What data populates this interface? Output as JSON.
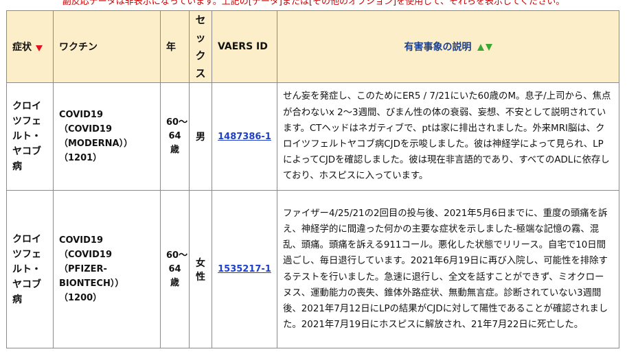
{
  "top_note": "副反応データは非表示になっています。上記の[データ]または[その他のオプション]を使用して、それらを表示してください。",
  "headers": {
    "symptom": "症状",
    "vaccine": "ワクチン",
    "year": "年",
    "sex": [
      "セ",
      "ッ",
      "ク",
      "ス"
    ],
    "vaers_id": "VAERS ID",
    "description": "有害事象の説明"
  },
  "rows": [
    {
      "symptom": [
        "クロイ",
        "ツフェ",
        "ルト・",
        "ヤコブ",
        "病"
      ],
      "vaccine": [
        "COVID19（COVID19",
        "（MODERNA））",
        "（1201）"
      ],
      "age": [
        "60〜",
        "64歳"
      ],
      "sex": "男",
      "vaers_id": "1487386-1",
      "description": "せん妄を発症し、このためにER5 / 7/21にいた60歳のM。息子/上司から、焦点が合わないx 2〜3週間、びまん性の体の衰弱、妄想、不安として説明されています。CTヘッドはネガティブで、ptは家に排出されました。外来MRI脳は、クロイツフェルトヤコブ病CJDを示唆しました。彼は神経学によって見られ、LPによってCJDを確認しました。彼は現在非言語的であり、すべてのADLに依存しており、ホスピスに入っています。"
    },
    {
      "symptom": [
        "クロイ",
        "ツフェ",
        "ルト・",
        "ヤコブ",
        "病"
      ],
      "vaccine": [
        "COVID19（COVID19",
        "（PFIZER-",
        "BIONTECH））",
        "（1200）"
      ],
      "age": [
        "60〜",
        "64歳"
      ],
      "sex": [
        "女",
        "性"
      ],
      "vaers_id": "1535217-1",
      "description": "ファイザー4/25/21の2回目の投与後、2021年5月6日までに、重度の頭痛を訴え、神経学的に間違った何かの主要な症状を示しました-極端な記憶の霧、混乱、頭痛。頭痛を訴える911コール。悪化した状態でリリース。自宅で10日間過ごし、毎日退行しています。2021年6月19日に再び入院し、可能性を排除するテストを行いました。急速に退行し、全文を話すことができず、ミオクローヌス、運動能力の喪失、錐体外路症状、無動無言症。診断されていない3週間後、2021年7月12日にLPの結果がCJDに対して陽性であることが確認されました。2021年7月19日にホスピスに解放され、21年7月22日に死亡した。"
    }
  ],
  "colors": {
    "header_bg": "#fbeec9",
    "link": "#1d3fc9",
    "sort_arrow_red": "#e0141e",
    "sort_arrow_green": "#3aa832",
    "note_red": "#cc0000"
  },
  "icons": {
    "symptom_sort": "sort-down-arrow-icon",
    "description_sort": "sort-up-down-arrows-icon"
  }
}
